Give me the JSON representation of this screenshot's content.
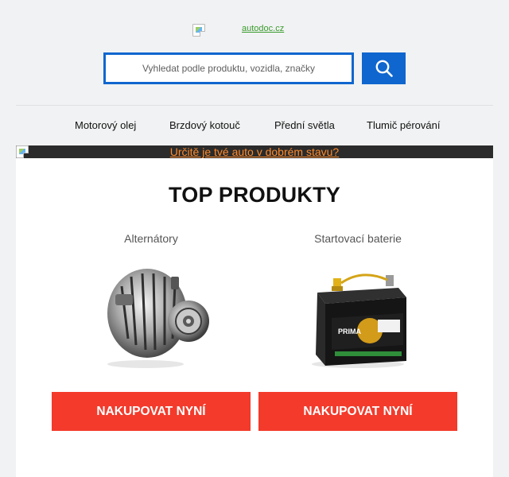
{
  "header": {
    "logo_alt": "autodoc.cz"
  },
  "search": {
    "placeholder": "Vyhledat podle produktu, vozidla, značky",
    "button_icon": "search-icon"
  },
  "nav": {
    "items": [
      {
        "label": "Motorový olej"
      },
      {
        "label": "Brzdový kotouč"
      },
      {
        "label": "Přední světla"
      },
      {
        "label": "Tlumič pérování"
      }
    ]
  },
  "banner": {
    "text": "Určitě je tvé auto v dobrém stavu?"
  },
  "top_products": {
    "title": "TOP PRODUKTY",
    "products": [
      {
        "category": "Alternátory",
        "image_icon": "alternator-image",
        "button_label": "NAKUPOVAT NYNÍ"
      },
      {
        "category": "Startovací baterie",
        "image_icon": "car-battery-image",
        "button_label": "NAKUPOVAT NYNÍ"
      }
    ]
  },
  "colors": {
    "accent_blue": "#0f66cf",
    "cta_red": "#f33a2b",
    "banner_link": "#ff8a2b",
    "logo_link": "#3a9c2e"
  }
}
